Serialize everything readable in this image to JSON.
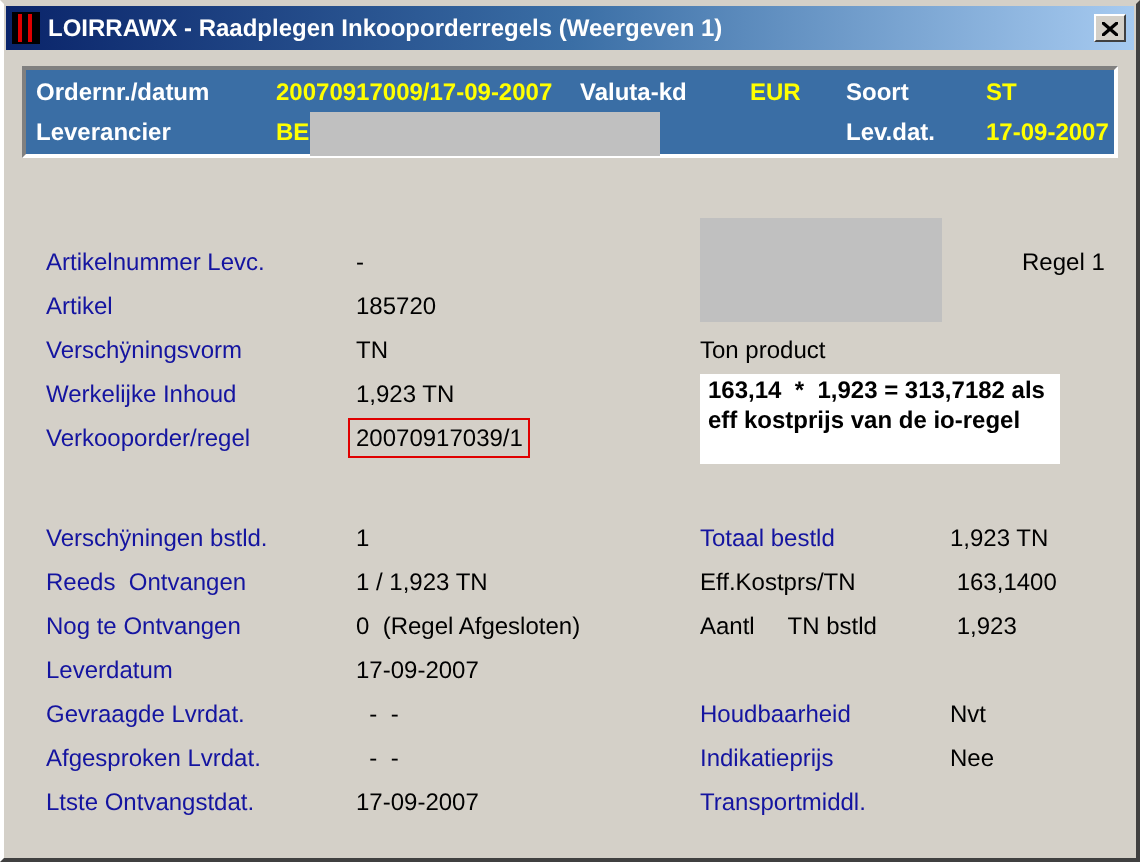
{
  "window": {
    "title": "LOIRRAWX - Raadplegen Inkooporderregels (Weergeven 1)"
  },
  "header": {
    "order": {
      "label": "Ordernr./datum",
      "value": "20070917009/17-09-2007"
    },
    "currency": {
      "label": "Valuta-kd",
      "value": "EUR"
    },
    "type": {
      "label": "Soort",
      "value": "ST"
    },
    "supplier": {
      "label": "Leverancier",
      "value": "BE",
      "redacted": true
    },
    "delivery_date": {
      "label": "Lev.dat.",
      "value": "17-09-2007"
    }
  },
  "line_label": "Regel 1",
  "image_redacted": true,
  "unit_description": "Ton product",
  "note": "163,14  *  1,923 = 313,7182 als eff kostprijs van de io-regel",
  "details": [
    {
      "label": "Artikelnummer Levc.",
      "value": "-",
      "highlighted": false
    },
    {
      "label": "Artikel",
      "value": "185720",
      "highlighted": false
    },
    {
      "label": "Verschÿningsvorm",
      "value": "TN",
      "highlighted": false
    },
    {
      "label": "Werkelijke Inhoud",
      "value": "1,923 TN",
      "highlighted": false
    },
    {
      "label": "Verkooporder/regel",
      "value": "20070917039/1",
      "highlighted": true
    }
  ],
  "receipts": [
    {
      "label": "Verschÿningen bstld.",
      "value": "1"
    },
    {
      "label": "Reeds  Ontvangen",
      "value": "1 / 1,923 TN"
    },
    {
      "label": "Nog te Ontvangen",
      "value": "0  (Regel Afgesloten)"
    },
    {
      "label": "Leverdatum",
      "value": "17-09-2007"
    },
    {
      "label": "Gevraagde Lvrdat.",
      "value": "  -  -"
    },
    {
      "label": "Afgesproken Lvrdat.",
      "value": "  -  -"
    },
    {
      "label": "Ltste Ontvangstdat.",
      "value": "17-09-2007"
    }
  ],
  "summary": [
    {
      "kind": "field",
      "label": "Totaal bestld",
      "value": "1,923 TN"
    },
    {
      "kind": "info",
      "label": "Eff.Kostprs/TN",
      "value": " 163,1400"
    },
    {
      "kind": "info",
      "label": "Aantl     TN bstld",
      "value": " 1,923"
    }
  ],
  "properties": [
    {
      "kind": "field",
      "label": "Houdbaarheid",
      "value": "Nvt"
    },
    {
      "kind": "field",
      "label": "Indikatieprijs",
      "value": "Nee"
    },
    {
      "kind": "field",
      "label": "Transportmiddl."
    }
  ]
}
